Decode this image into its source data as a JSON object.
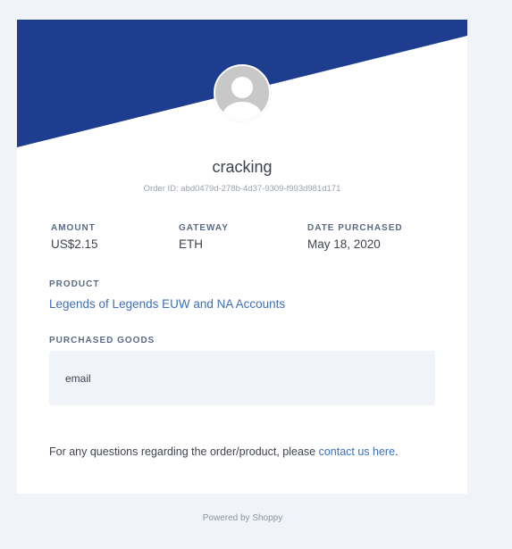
{
  "theme": {
    "banner_color": "#1e3d8f",
    "accent_link_color": "#3d6fb6",
    "background": "#f0f3f8"
  },
  "profile": {
    "avatar_icon": "user-avatar-icon",
    "username": "cracking",
    "order_id": "Order ID: abd0479d-278b-4d37-9309-f993d981d171"
  },
  "details": {
    "amount_label": "AMOUNT",
    "amount_value": "US$2.15",
    "gateway_label": "GATEWAY",
    "gateway_value": "ETH",
    "date_label": "DATE PURCHASED",
    "date_value": "May 18, 2020"
  },
  "product": {
    "label": "PRODUCT",
    "name": "Legends of Legends EUW and NA Accounts"
  },
  "goods": {
    "label": "PURCHASED GOODS",
    "content": "email"
  },
  "support": {
    "text_before": "For any questions regarding the order/product, please ",
    "link_text": "contact us here",
    "text_after": "."
  },
  "footer": {
    "powered_by": "Powered by Shoppy"
  }
}
